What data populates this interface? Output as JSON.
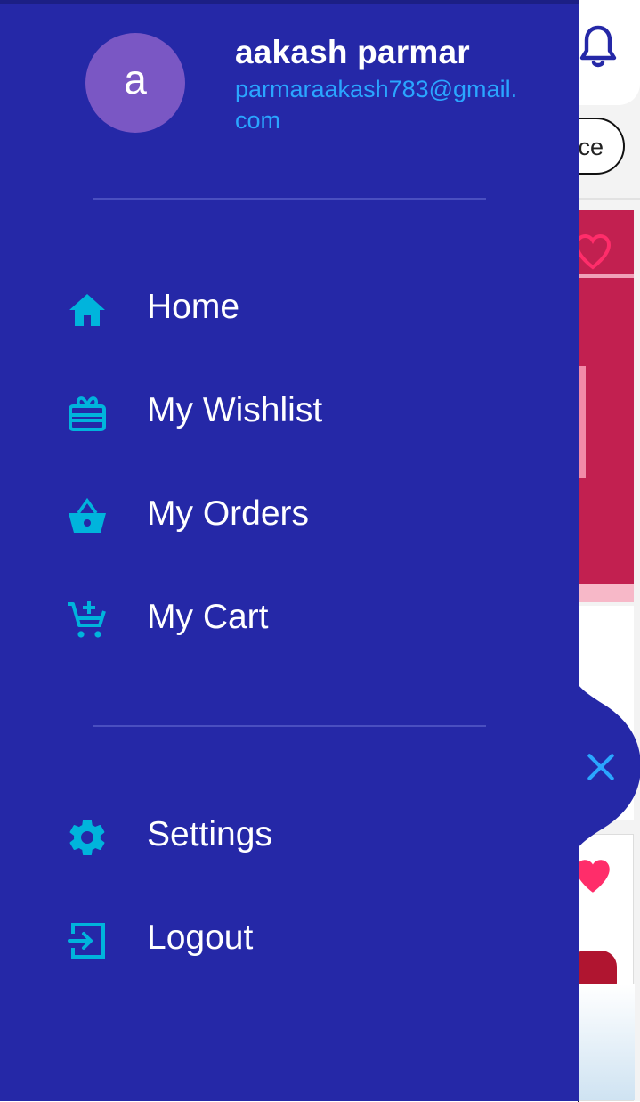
{
  "user": {
    "avatar_letter": "a",
    "name": "aakash parmar",
    "email": "parmaraakash783@gmail.com"
  },
  "menu": {
    "items": [
      {
        "label": "Home",
        "icon": "home-icon"
      },
      {
        "label": "My Wishlist",
        "icon": "gift-card-icon"
      },
      {
        "label": "My Orders",
        "icon": "basket-icon"
      },
      {
        "label": "My Cart",
        "icon": "add-to-cart-icon"
      }
    ],
    "bottom_items": [
      {
        "label": "Settings",
        "icon": "gear-icon"
      },
      {
        "label": "Logout",
        "icon": "logout-icon"
      }
    ]
  },
  "background": {
    "pill_text": "ce"
  },
  "colors": {
    "drawer_bg": "#2528a7",
    "accent_icon": "#00b4dc",
    "email": "#2aa6ff",
    "avatar_bg": "#7a57c4",
    "label": "#ffffff"
  }
}
